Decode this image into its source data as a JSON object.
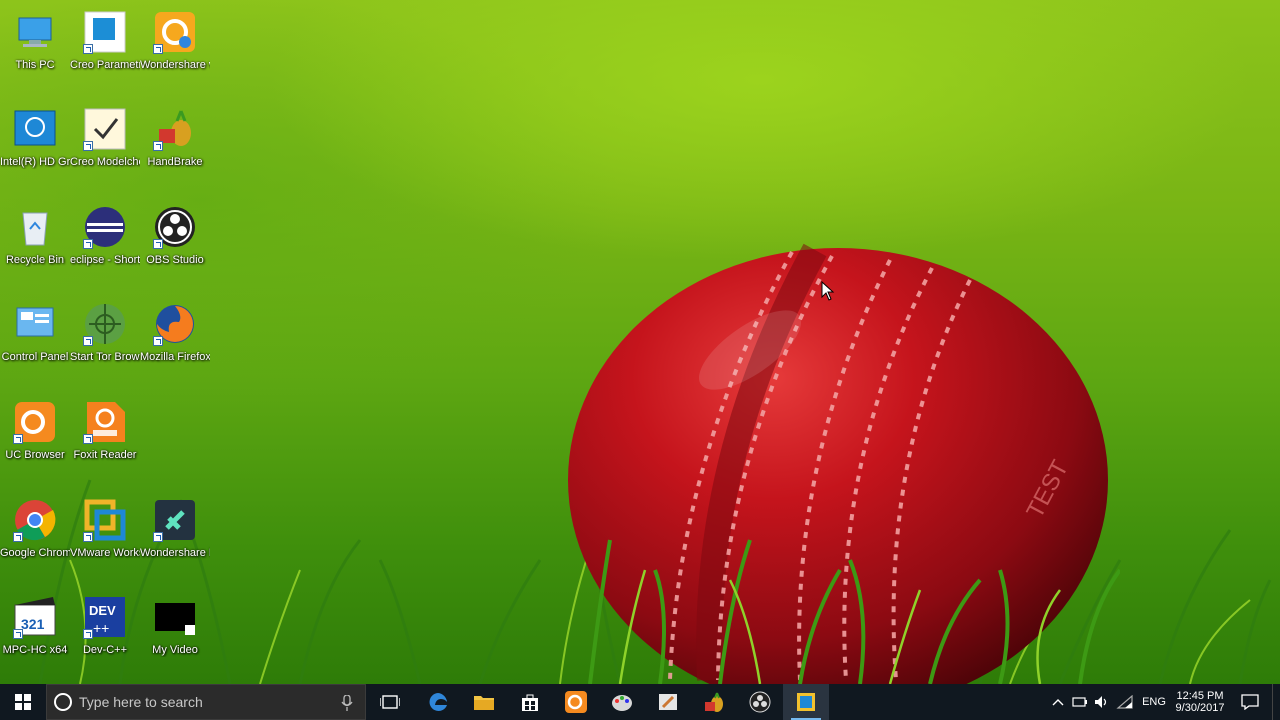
{
  "desktop": {
    "icons": [
      {
        "label": "This PC",
        "icon": "this-pc-icon"
      },
      {
        "label": "Creo Parametr...",
        "icon": "creo-parametric-icon"
      },
      {
        "label": "Wondershare video edito...",
        "icon": "wondershare-video-editor-icon"
      },
      {
        "label": "Intel(R) HD Graphics ...",
        "icon": "intel-graphics-icon"
      },
      {
        "label": "Creo Modelche...",
        "icon": "creo-modelcheck-icon"
      },
      {
        "label": "HandBrake",
        "icon": "handbrake-icon"
      },
      {
        "label": "Recycle Bin",
        "icon": "recycle-bin-icon"
      },
      {
        "label": "eclipse - Shortcut",
        "icon": "eclipse-icon"
      },
      {
        "label": "OBS Studio",
        "icon": "obs-studio-icon"
      },
      {
        "label": "Control Panel",
        "icon": "control-panel-icon"
      },
      {
        "label": "Start Tor Browser",
        "icon": "tor-browser-icon"
      },
      {
        "label": "Mozilla Firefox",
        "icon": "firefox-icon"
      },
      {
        "label": "UC Browser",
        "icon": "uc-browser-icon"
      },
      {
        "label": "Foxit Reader",
        "icon": "foxit-reader-icon"
      },
      {
        "label": "Google Chrome",
        "icon": "chrome-icon"
      },
      {
        "label": "VMware Workstati...",
        "icon": "vmware-icon"
      },
      {
        "label": "Wondershare Filmora",
        "icon": "filmora-icon"
      },
      {
        "label": "MPC-HC x64",
        "icon": "mpc-hc-icon"
      },
      {
        "label": "Dev-C++",
        "icon": "dev-cpp-icon"
      },
      {
        "label": "My Video",
        "icon": "video-file-icon"
      }
    ]
  },
  "wallpaper": {
    "ball_text": "TEST"
  },
  "taskbar": {
    "search_placeholder": "Type here to search",
    "pinned": [
      "edge-icon",
      "file-explorer-icon",
      "store-icon",
      "uc-browser-icon",
      "paint-icon",
      "sticky-app-icon",
      "handbrake-icon",
      "obs-studio-icon",
      "app-window-icon"
    ],
    "tray": {
      "language": "ENG",
      "time": "12:45 PM",
      "date": "9/30/2017"
    }
  },
  "colors": {
    "taskbar": "#101820",
    "accent": "#76b9ed",
    "ball": "#b2141c"
  }
}
